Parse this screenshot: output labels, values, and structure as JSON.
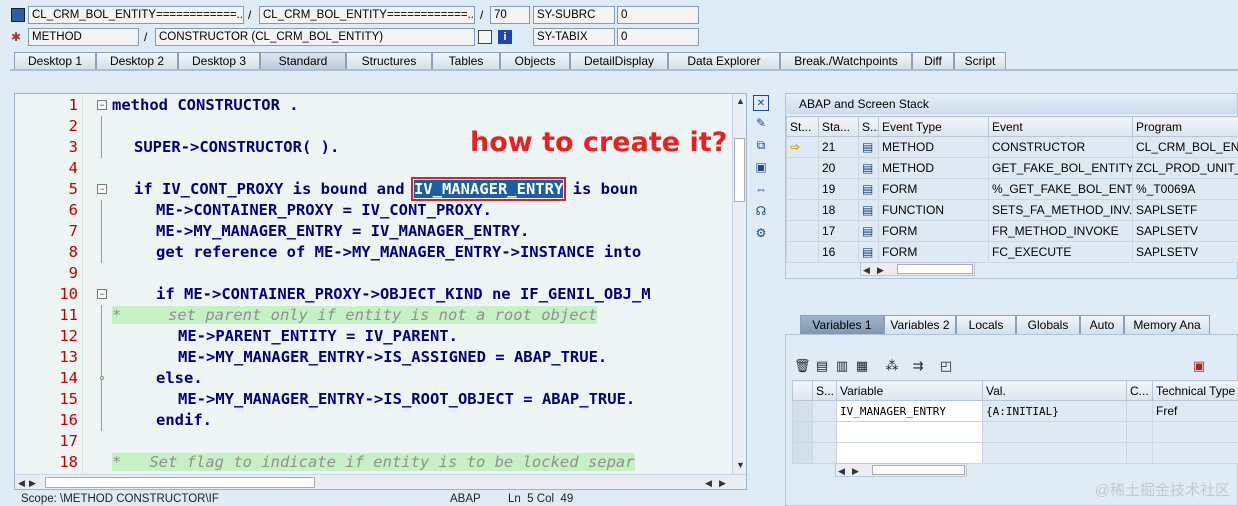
{
  "toolbar": {
    "field1": "CL_CRM_BOL_ENTITY============...",
    "field2": "CL_CRM_BOL_ENTITY============...",
    "line": "70",
    "sysvar1": "SY-SUBRC",
    "sysvar1_value": "0",
    "field3": "METHOD",
    "field4": "CONSTRUCTOR (CL_CRM_BOL_ENTITY)",
    "sysvar2": "SY-TABIX",
    "sysvar2_value": "0",
    "sep": "/"
  },
  "tabs": [
    "Desktop 1",
    "Desktop 2",
    "Desktop 3",
    "Standard",
    "Structures",
    "Tables",
    "Objects",
    "DetailDisplay",
    "Data Explorer",
    "Break./Watchpoints",
    "Diff",
    "Script"
  ],
  "active_tab": "Standard",
  "editor": {
    "annotation": "how to create it?",
    "line_numbers": [
      "1",
      "2",
      "3",
      "4",
      "5",
      "6",
      "7",
      "8",
      "9",
      "10",
      "11",
      "12",
      "13",
      "14",
      "15",
      "16",
      "17",
      "18"
    ],
    "lines": [
      {
        "text": "method CONSTRUCTOR .",
        "indent": 0
      },
      {
        "text": "",
        "indent": 0
      },
      {
        "text": "SUPER->CONSTRUCTOR( ).",
        "indent": 1
      },
      {
        "text": "",
        "indent": 0
      },
      {
        "text": "if IV_CONT_PROXY is bound and ",
        "indent": 1,
        "highlight": "IV_MANAGER_ENTRY",
        "after": " is boun"
      },
      {
        "text": "ME->CONTAINER_PROXY = IV_CONT_PROXY.",
        "indent": 2
      },
      {
        "text": "ME->MY_MANAGER_ENTRY = IV_MANAGER_ENTRY.",
        "indent": 2
      },
      {
        "text": "get reference of ME->MY_MANAGER_ENTRY->INSTANCE into",
        "indent": 2
      },
      {
        "text": "",
        "indent": 0
      },
      {
        "text": "if ME->CONTAINER_PROXY->OBJECT_KIND ne IF_GENIL_OBJ_M",
        "indent": 2
      },
      {
        "text": "*     set parent only if entity is not a root object",
        "indent": 0,
        "comment": true
      },
      {
        "text": "ME->PARENT_ENTITY = IV_PARENT.",
        "indent": 3
      },
      {
        "text": "ME->MY_MANAGER_ENTRY->IS_ASSIGNED = ABAP_TRUE.",
        "indent": 3
      },
      {
        "text": "else.",
        "indent": 2
      },
      {
        "text": "ME->MY_MANAGER_ENTRY->IS_ROOT_OBJECT = ABAP_TRUE.",
        "indent": 3
      },
      {
        "text": "endif.",
        "indent": 2
      },
      {
        "text": "",
        "indent": 0
      },
      {
        "text": "*   Set flag to indicate if entity is to be locked separ",
        "indent": 0,
        "comment": true
      }
    ]
  },
  "status_bar": {
    "scope": "Scope: \\METHOD CONSTRUCTOR\\IF",
    "lang": "ABAP",
    "position": "Ln  5 Col  49"
  },
  "stack": {
    "title": "ABAP and Screen Stack",
    "columns": [
      "St...",
      "Sta...",
      "S...",
      "Event Type",
      "Event",
      "Program"
    ],
    "rows": [
      {
        "current": true,
        "level": "21",
        "type": "METHOD",
        "event": "CONSTRUCTOR",
        "program": "CL_CRM_BOL_ENTI"
      },
      {
        "current": false,
        "level": "20",
        "type": "METHOD",
        "event": "GET_FAKE_BOL_ENTITY",
        "program": "ZCL_PROD_UNIT_T"
      },
      {
        "current": false,
        "level": "19",
        "type": "FORM",
        "event": "%_GET_FAKE_BOL_ENT...",
        "program": "%_T0069A"
      },
      {
        "current": false,
        "level": "18",
        "type": "FUNCTION",
        "event": "SETS_FA_METHOD_INV...",
        "program": "SAPLSETF"
      },
      {
        "current": false,
        "level": "17",
        "type": "FORM",
        "event": "FR_METHOD_INVOKE",
        "program": "SAPLSETV"
      },
      {
        "current": false,
        "level": "16",
        "type": "FORM",
        "event": "FC_EXECUTE",
        "program": "SAPLSETV"
      }
    ]
  },
  "var_tabs": [
    "Variables 1",
    "Variables 2",
    "Locals",
    "Globals",
    "Auto",
    "Memory Ana"
  ],
  "active_var_tab": "Variables 1",
  "variables": {
    "columns": [
      "S...",
      "Variable",
      "Val.",
      "C...",
      "Technical Type"
    ],
    "rows": [
      {
        "variable": "IV_MANAGER_ENTRY",
        "value": "{A:INITIAL}",
        "c": "",
        "type": "Fref"
      },
      {
        "variable": "",
        "value": "",
        "c": "",
        "type": ""
      },
      {
        "variable": "",
        "value": "",
        "c": "",
        "type": ""
      }
    ]
  },
  "watermark": "@稀土掘金技术社区"
}
